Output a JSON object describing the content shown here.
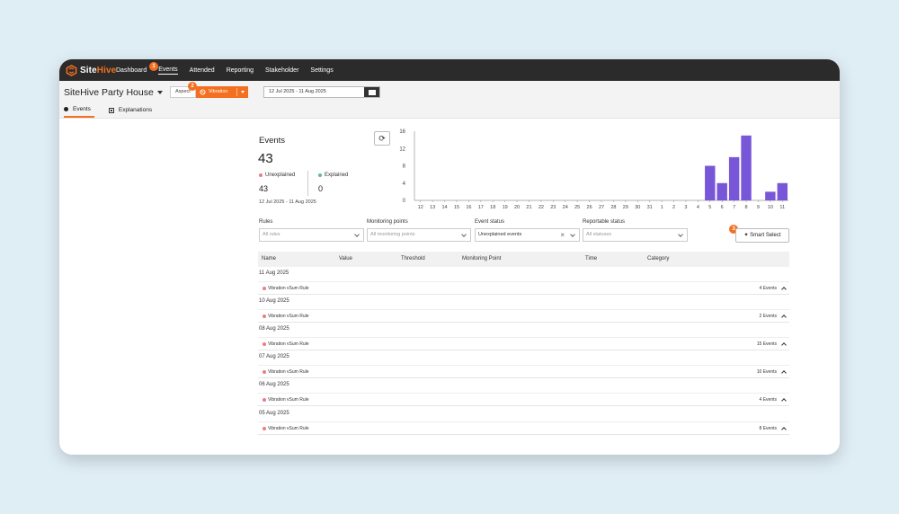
{
  "app": {
    "logo_prefix": "Site",
    "logo_accent": "Hive"
  },
  "nav": {
    "items": [
      {
        "label": "Dashboard"
      },
      {
        "label": "Events"
      },
      {
        "label": "Attended"
      },
      {
        "label": "Reporting"
      },
      {
        "label": "Stakeholder"
      },
      {
        "label": "Settings"
      }
    ],
    "active": "Events"
  },
  "header": {
    "site_name": "SiteHive Party House",
    "aspect_label": "Aspect",
    "aspect_value": "Vibration",
    "date_range": "12 Jul 2025 - 11 Aug 2025"
  },
  "tabs": [
    {
      "label": "Events",
      "active": true
    },
    {
      "label": "Explanations",
      "active": false
    }
  ],
  "badges": {
    "one": "1",
    "two": "2",
    "three": "3"
  },
  "summary": {
    "title": "Events",
    "total": "43",
    "unexplained_label": "Unexplained",
    "unexplained_value": "43",
    "explained_label": "Explained",
    "explained_value": "0",
    "range": "12 Jul 2025 - 11 Aug 2025"
  },
  "colors": {
    "accent": "#f37021",
    "bar": "#7856d8",
    "unexplained": "#e87d8a",
    "explained": "#5cc08a"
  },
  "chart_data": {
    "type": "bar",
    "categories": [
      "12",
      "13",
      "14",
      "15",
      "16",
      "17",
      "18",
      "19",
      "20",
      "21",
      "22",
      "23",
      "24",
      "25",
      "26",
      "27",
      "28",
      "29",
      "30",
      "31",
      "1",
      "2",
      "3",
      "4",
      "5",
      "6",
      "7",
      "8",
      "9",
      "10",
      "11"
    ],
    "values": [
      0,
      0,
      0,
      0,
      0,
      0,
      0,
      0,
      0,
      0,
      0,
      0,
      0,
      0,
      0,
      0,
      0,
      0,
      0,
      0,
      0,
      0,
      0,
      0,
      8,
      4,
      10,
      15,
      0,
      2,
      4
    ],
    "y_ticks": [
      "0",
      "4",
      "8",
      "12",
      "16"
    ],
    "ylim": [
      0,
      16
    ]
  },
  "filters": {
    "rules": {
      "label": "Rules",
      "placeholder": "All rules"
    },
    "monitoring": {
      "label": "Monitoring points",
      "placeholder": "All monitoring points"
    },
    "status": {
      "label": "Event status",
      "value": "Unexplained events"
    },
    "reportable": {
      "label": "Reportable status",
      "placeholder": "All statuses"
    },
    "smart_select": "Smart Select"
  },
  "table": {
    "headers": [
      "Name",
      "Value",
      "Threshold",
      "Monitoring Point",
      "Time",
      "Category"
    ],
    "groups": [
      {
        "date": "11 Aug 2025",
        "rule": "Vibration vSum Rule",
        "count": "4 Events"
      },
      {
        "date": "10 Aug 2025",
        "rule": "Vibration vSum Rule",
        "count": "2 Events"
      },
      {
        "date": "08 Aug 2025",
        "rule": "Vibration vSum Rule",
        "count": "15 Events"
      },
      {
        "date": "07 Aug 2025",
        "rule": "Vibration vSum Rule",
        "count": "10 Events"
      },
      {
        "date": "06 Aug 2025",
        "rule": "Vibration vSum Rule",
        "count": "4 Events"
      },
      {
        "date": "05 Aug 2025",
        "rule": "Vibration vSum Rule",
        "count": "8 Events"
      }
    ]
  }
}
